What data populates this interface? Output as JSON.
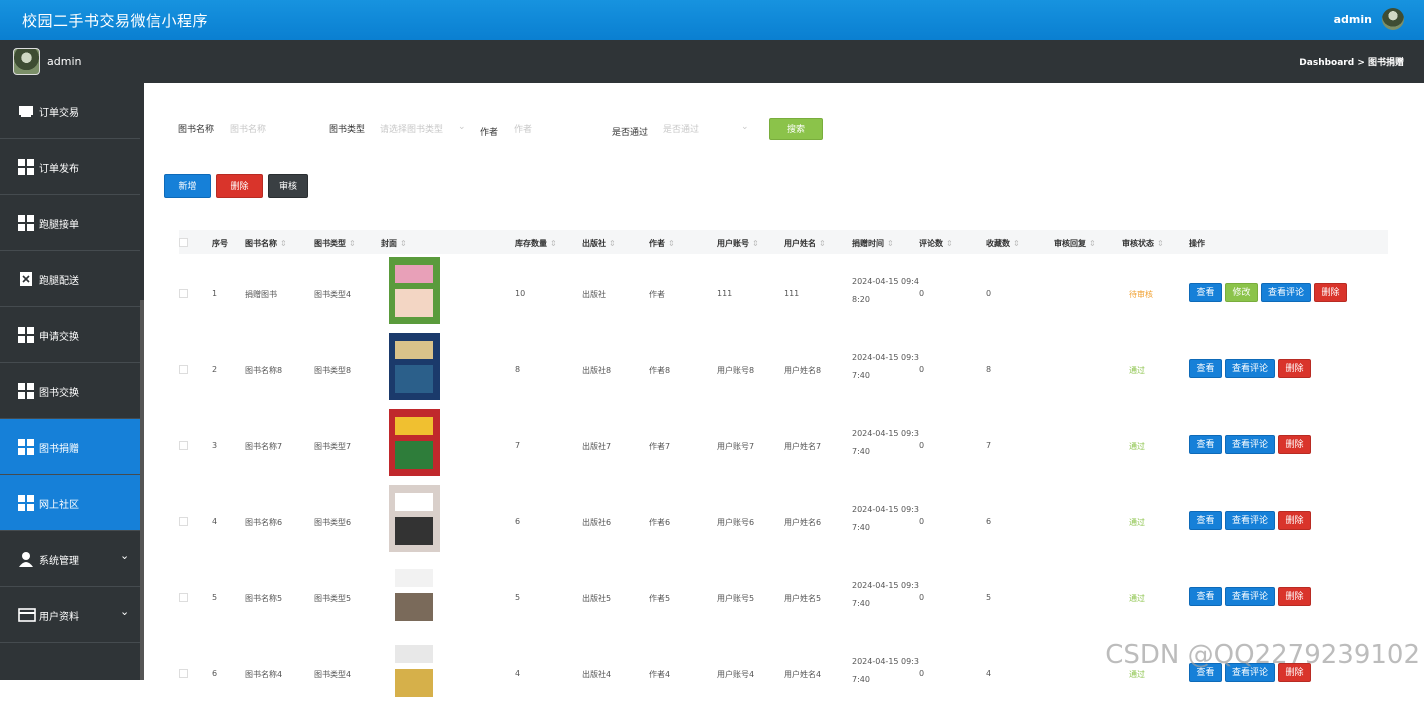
{
  "header": {
    "app_title": "校园二手书交易微信小程序",
    "user": "admin"
  },
  "subheader": {
    "name": "admin",
    "breadcrumb": "Dashboard > 图书捐赠"
  },
  "sidebar": {
    "items": [
      {
        "label": "订单交易",
        "icon": "store-icon"
      },
      {
        "label": "订单发布",
        "icon": "grid-icon"
      },
      {
        "label": "跑腿接单",
        "icon": "grid-icon"
      },
      {
        "label": "跑腿配送",
        "icon": "clipboard-x-icon"
      },
      {
        "label": "申请交换",
        "icon": "grid-icon"
      },
      {
        "label": "图书交换",
        "icon": "grid-icon"
      },
      {
        "label": "图书捐赠",
        "icon": "grid-icon",
        "active": true
      },
      {
        "label": "网上社区",
        "icon": "grid-icon",
        "active": true
      },
      {
        "label": "系统管理",
        "icon": "user-icon",
        "expandable": true
      },
      {
        "label": "用户资料",
        "icon": "card-icon",
        "expandable": true
      }
    ]
  },
  "filters": {
    "name_label": "图书名称",
    "name_placeholder": "图书名称",
    "type_label": "图书类型",
    "type_placeholder": "请选择图书类型",
    "author_label": "作者",
    "author_placeholder": "作者",
    "pass_label": "是否通过",
    "pass_placeholder": "是否通过",
    "search_label": "搜索"
  },
  "actions": {
    "add": "新增",
    "delete": "删除",
    "review": "审核"
  },
  "table": {
    "headers": [
      "序号",
      "图书名称",
      "图书类型",
      "封面",
      "库存数量",
      "出版社",
      "作者",
      "用户账号",
      "用户姓名",
      "捐赠时间",
      "评论数",
      "收藏数",
      "审核回复",
      "审核状态",
      "操作"
    ],
    "rows": [
      {
        "no": "1",
        "name": "捐赠图书",
        "type": "图书类型4",
        "stock": "10",
        "publisher": "出版社",
        "author": "作者",
        "account": "111",
        "username": "111",
        "time1": "2024-04-15 09:4",
        "time2": "8:20",
        "comments": "0",
        "favs": "0",
        "reply": "",
        "status": "待审核",
        "status_color": "#f0a030",
        "buttons": [
          "查看",
          "修改",
          "查看评论",
          "删除"
        ]
      },
      {
        "no": "2",
        "name": "图书名称8",
        "type": "图书类型8",
        "stock": "8",
        "publisher": "出版社8",
        "author": "作者8",
        "account": "用户账号8",
        "username": "用户姓名8",
        "time1": "2024-04-15 09:3",
        "time2": "7:40",
        "comments": "0",
        "favs": "8",
        "reply": "",
        "status": "通过",
        "status_color": "#8bc34a",
        "buttons": [
          "查看",
          "查看评论",
          "删除"
        ]
      },
      {
        "no": "3",
        "name": "图书名称7",
        "type": "图书类型7",
        "stock": "7",
        "publisher": "出版社7",
        "author": "作者7",
        "account": "用户账号7",
        "username": "用户姓名7",
        "time1": "2024-04-15 09:3",
        "time2": "7:40",
        "comments": "0",
        "favs": "7",
        "reply": "",
        "status": "通过",
        "status_color": "#8bc34a",
        "buttons": [
          "查看",
          "查看评论",
          "删除"
        ]
      },
      {
        "no": "4",
        "name": "图书名称6",
        "type": "图书类型6",
        "stock": "6",
        "publisher": "出版社6",
        "author": "作者6",
        "account": "用户账号6",
        "username": "用户姓名6",
        "time1": "2024-04-15 09:3",
        "time2": "7:40",
        "comments": "0",
        "favs": "6",
        "reply": "",
        "status": "通过",
        "status_color": "#8bc34a",
        "buttons": [
          "查看",
          "查看评论",
          "删除"
        ]
      },
      {
        "no": "5",
        "name": "图书名称5",
        "type": "图书类型5",
        "stock": "5",
        "publisher": "出版社5",
        "author": "作者5",
        "account": "用户账号5",
        "username": "用户姓名5",
        "time1": "2024-04-15 09:3",
        "time2": "7:40",
        "comments": "0",
        "favs": "5",
        "reply": "",
        "status": "通过",
        "status_color": "#8bc34a",
        "buttons": [
          "查看",
          "查看评论",
          "删除"
        ]
      },
      {
        "no": "6",
        "name": "图书名称4",
        "type": "图书类型4",
        "stock": "4",
        "publisher": "出版社4",
        "author": "作者4",
        "account": "用户账号4",
        "username": "用户姓名4",
        "time1": "2024-04-15 09:3",
        "time2": "7:40",
        "comments": "0",
        "favs": "4",
        "reply": "",
        "status": "通过",
        "status_color": "#8bc34a",
        "buttons": [
          "查看",
          "查看评论",
          "删除"
        ]
      }
    ]
  },
  "watermark": "CSDN @QQ2279239102"
}
